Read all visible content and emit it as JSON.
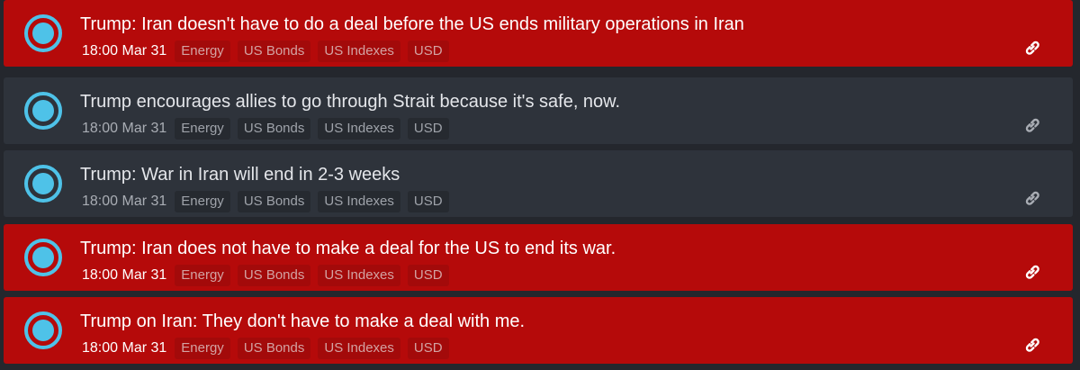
{
  "feed": {
    "items": [
      {
        "headline": "Trump: Iran doesn't have to do a deal before the US ends military operations in Iran",
        "time": "18:00 Mar 31",
        "tags": [
          "Energy",
          "US Bonds",
          "US Indexes",
          "USD"
        ],
        "highlight": "red",
        "icon": "circle-bullet-icon",
        "link_icon": "link-icon"
      },
      {
        "headline": "Trump encourages allies to go through Strait because it's safe, now.",
        "time": "18:00 Mar 31",
        "tags": [
          "Energy",
          "US Bonds",
          "US Indexes",
          "USD"
        ],
        "highlight": "gray",
        "icon": "circle-bullet-icon",
        "link_icon": "link-icon"
      },
      {
        "headline": "Trump: War in Iran will end in 2-3 weeks",
        "time": "18:00 Mar 31",
        "tags": [
          "Energy",
          "US Bonds",
          "US Indexes",
          "USD"
        ],
        "highlight": "gray",
        "icon": "circle-bullet-icon",
        "link_icon": "link-icon"
      },
      {
        "headline": "Trump: Iran does not have to make a deal for the US to end its war.",
        "time": "18:00 Mar 31",
        "tags": [
          "Energy",
          "US Bonds",
          "US Indexes",
          "USD"
        ],
        "highlight": "red",
        "icon": "circle-bullet-icon",
        "link_icon": "link-icon"
      },
      {
        "headline": "Trump on Iran: They don't have to make a deal with me.",
        "time": "18:00 Mar 31",
        "tags": [
          "Energy",
          "US Bonds",
          "US Indexes",
          "USD"
        ],
        "highlight": "red",
        "icon": "circle-bullet-icon",
        "link_icon": "link-icon"
      }
    ]
  },
  "colors": {
    "background": "#24272d",
    "red_item": "#b50a0a",
    "gray_item": "#2e333b",
    "bullet": "#4ec2e8"
  }
}
